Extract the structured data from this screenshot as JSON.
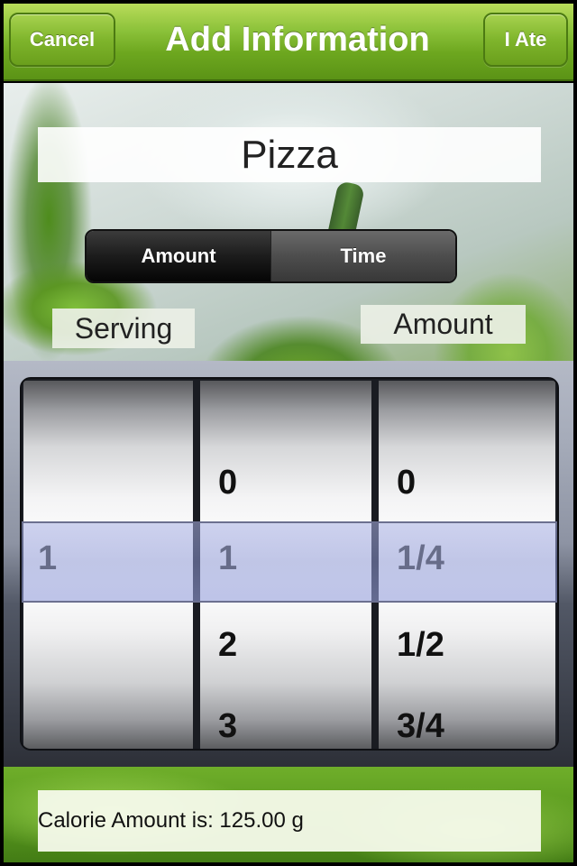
{
  "navbar": {
    "title": "Add Information",
    "cancel_label": "Cancel",
    "ate_label": "I Ate"
  },
  "food": {
    "name": "Pizza"
  },
  "segmented": {
    "options": [
      "Amount",
      "Time"
    ],
    "selected": "Amount"
  },
  "labels": {
    "serving": "Serving",
    "amount": "Amount"
  },
  "picker": {
    "serving_column": [
      "1"
    ],
    "whole_column": [
      "0",
      "1",
      "2",
      "3"
    ],
    "fraction_column": [
      "0",
      "1/4",
      "1/2",
      "3/4"
    ],
    "selected": {
      "serving": "1",
      "whole": "1",
      "fraction": "1/4"
    }
  },
  "footer": {
    "calorie_text": "Calorie Amount is: 125.00 g"
  },
  "colors": {
    "nav_green": "#7fb52c",
    "selection_tint": "#a0a8dc"
  }
}
